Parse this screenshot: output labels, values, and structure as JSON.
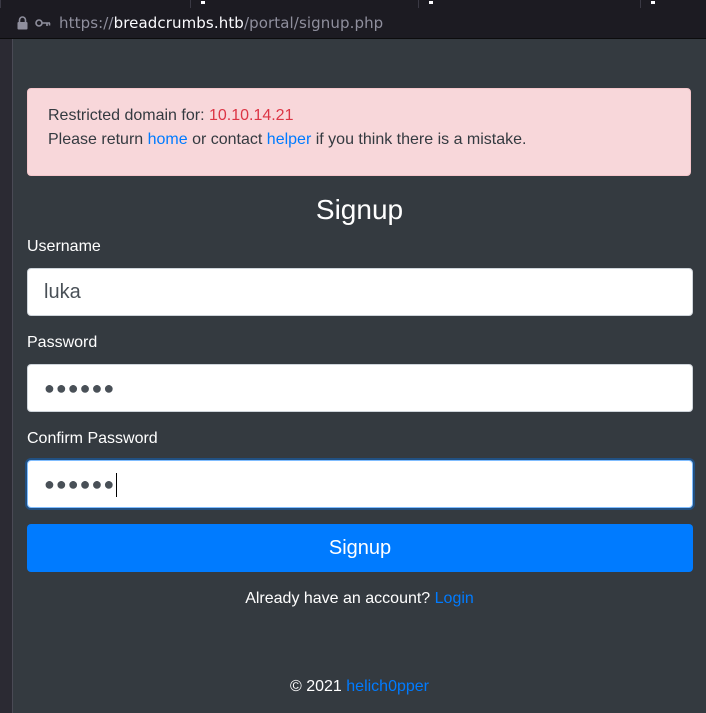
{
  "browser": {
    "url_scheme": "https://",
    "url_host": "breadcrumbs.htb",
    "url_path": "/portal/signup.php"
  },
  "alert": {
    "line1_prefix": "Restricted domain for: ",
    "ip": "10.10.14.21",
    "line2_prefix": "Please return ",
    "home_link": "home",
    "line2_middle": " or contact ",
    "helper_link": "helper",
    "line2_suffix": " if you think there is a mistake."
  },
  "form": {
    "title": "Signup",
    "username_label": "Username",
    "username_value": "luka",
    "password_label": "Password",
    "password_masked": "●●●●●●",
    "confirm_label": "Confirm Password",
    "confirm_masked": "●●●●●●",
    "submit_label": "Signup"
  },
  "account": {
    "prompt": "Already have an account? ",
    "login_link": "Login"
  },
  "footer": {
    "copyright": "© 2021 ",
    "author_link": "helich0pper"
  },
  "colors": {
    "page_bg": "#343a40",
    "alert_bg": "#f8d7da",
    "alert_ip": "#dc3545",
    "link": "#007bff",
    "button": "#007bff"
  }
}
